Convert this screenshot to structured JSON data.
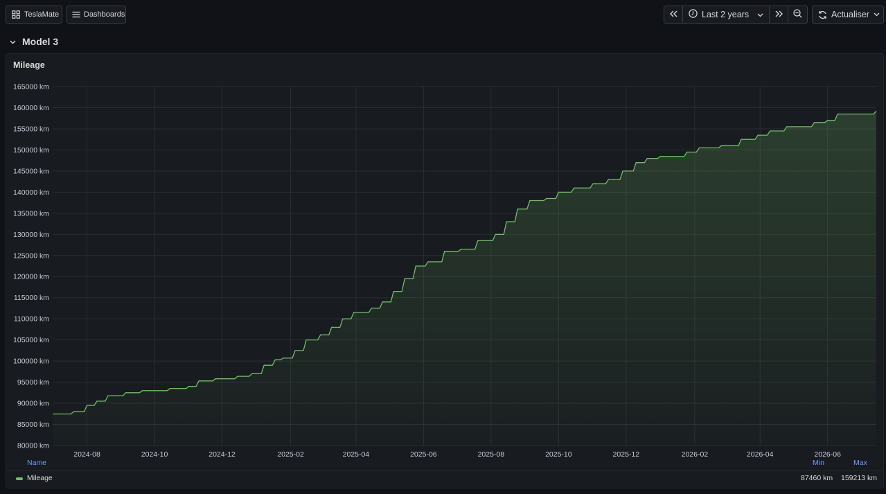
{
  "toolbar": {
    "home_label": "TeslaMate",
    "dashboards_label": "Dashboards",
    "time_range_label": "Last 2 years",
    "refresh_label": "Actualiser"
  },
  "row": {
    "title": "Model 3"
  },
  "panel": {
    "title": "Mileage"
  },
  "legend": {
    "name_header": "Name",
    "min_header": "Min",
    "max_header": "Max",
    "series_name": "Mileage",
    "min_value": "87460 km",
    "max_value": "159213 km"
  },
  "colors": {
    "series": "#73bf69",
    "accent": "#6e9fff"
  },
  "chart_data": {
    "type": "area",
    "unit": "km",
    "ylim": [
      80000,
      165000
    ],
    "ytick_step": 5000,
    "xlim": [
      "2024-07-01",
      "2026-07-15"
    ],
    "xticks": [
      "2024-08",
      "2024-10",
      "2024-12",
      "2025-02",
      "2025-04",
      "2025-06",
      "2025-08",
      "2025-10",
      "2025-12",
      "2026-02",
      "2026-04",
      "2026-06"
    ],
    "grid": true,
    "legend_placement": "bottom",
    "series": [
      {
        "name": "Mileage",
        "color": "#73bf69",
        "x": [
          "2024-07-01",
          "2024-07-20",
          "2024-08-01",
          "2024-08-10",
          "2024-08-20",
          "2024-09-05",
          "2024-09-20",
          "2024-10-15",
          "2024-11-01",
          "2024-11-10",
          "2024-11-25",
          "2024-12-15",
          "2024-12-28",
          "2025-01-08",
          "2025-01-18",
          "2025-01-25",
          "2025-02-05",
          "2025-02-15",
          "2025-02-28",
          "2025-03-10",
          "2025-03-20",
          "2025-03-30",
          "2025-04-15",
          "2025-04-25",
          "2025-05-05",
          "2025-05-15",
          "2025-05-25",
          "2025-06-05",
          "2025-06-20",
          "2025-07-05",
          "2025-07-20",
          "2025-08-05",
          "2025-08-15",
          "2025-08-25",
          "2025-09-05",
          "2025-09-20",
          "2025-10-01",
          "2025-10-15",
          "2025-11-01",
          "2025-11-15",
          "2025-11-28",
          "2025-12-10",
          "2025-12-20",
          "2026-01-01",
          "2026-01-25",
          "2026-02-05",
          "2026-02-25",
          "2026-03-15",
          "2026-03-30",
          "2026-04-10",
          "2026-04-25",
          "2026-05-20",
          "2026-06-01",
          "2026-06-10",
          "2026-07-15"
        ],
        "y": [
          87460,
          88000,
          89500,
          90500,
          91800,
          92500,
          93000,
          93500,
          94000,
          95300,
          95800,
          96400,
          97000,
          99000,
          100300,
          100700,
          102500,
          105000,
          106200,
          108000,
          110000,
          111500,
          112500,
          114000,
          116500,
          119500,
          122500,
          123500,
          126000,
          126500,
          128500,
          130000,
          133000,
          136000,
          138000,
          138500,
          140000,
          141000,
          142000,
          143000,
          145000,
          147000,
          148000,
          148500,
          149500,
          150500,
          151000,
          152500,
          153500,
          154500,
          155500,
          156500,
          157000,
          158500,
          159213
        ]
      }
    ]
  }
}
